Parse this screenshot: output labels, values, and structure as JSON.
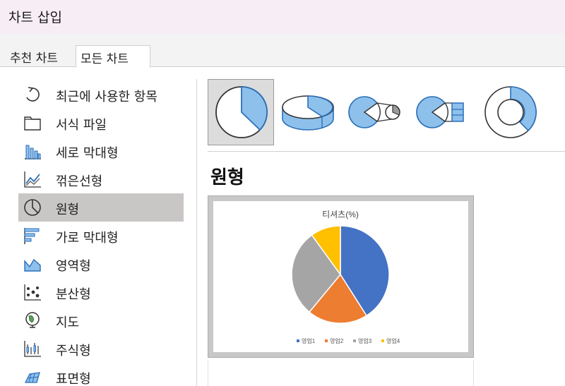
{
  "window": {
    "title": "차트 삽입"
  },
  "tabs": [
    {
      "label": "추천 차트"
    },
    {
      "label": "모든 차트"
    }
  ],
  "nav": {
    "items": [
      {
        "label": "최근에 사용한 항목",
        "icon": "recent-icon"
      },
      {
        "label": "서식 파일",
        "icon": "folder-icon"
      },
      {
        "label": "세로 막대형",
        "icon": "column-chart-icon"
      },
      {
        "label": "꺾은선형",
        "icon": "line-chart-icon"
      },
      {
        "label": "원형",
        "icon": "pie-chart-icon",
        "selected": true
      },
      {
        "label": "가로 막대형",
        "icon": "bar-chart-icon"
      },
      {
        "label": "영역형",
        "icon": "area-chart-icon"
      },
      {
        "label": "분산형",
        "icon": "scatter-chart-icon"
      },
      {
        "label": "지도",
        "icon": "map-chart-icon"
      },
      {
        "label": "주식형",
        "icon": "stock-chart-icon"
      },
      {
        "label": "표면형",
        "icon": "surface-chart-icon"
      }
    ]
  },
  "subtypes": [
    {
      "icon": "pie-icon",
      "selected": true
    },
    {
      "icon": "pie-3d-icon"
    },
    {
      "icon": "pie-of-pie-icon"
    },
    {
      "icon": "bar-of-pie-icon"
    },
    {
      "icon": "doughnut-icon"
    }
  ],
  "section": {
    "title": "원형"
  },
  "chart_data": {
    "type": "pie",
    "title": "티셔츠(%)",
    "categories": [
      "영업1",
      "영업2",
      "영업3",
      "영업4"
    ],
    "values": [
      41,
      20,
      29,
      10
    ],
    "colors": [
      "#4472c4",
      "#ed7d31",
      "#a5a5a5",
      "#ffc000"
    ],
    "legend": "bottom"
  },
  "colors": {
    "icon_fill": "#8ec0ec",
    "icon_stroke": "#2a6fb8"
  }
}
